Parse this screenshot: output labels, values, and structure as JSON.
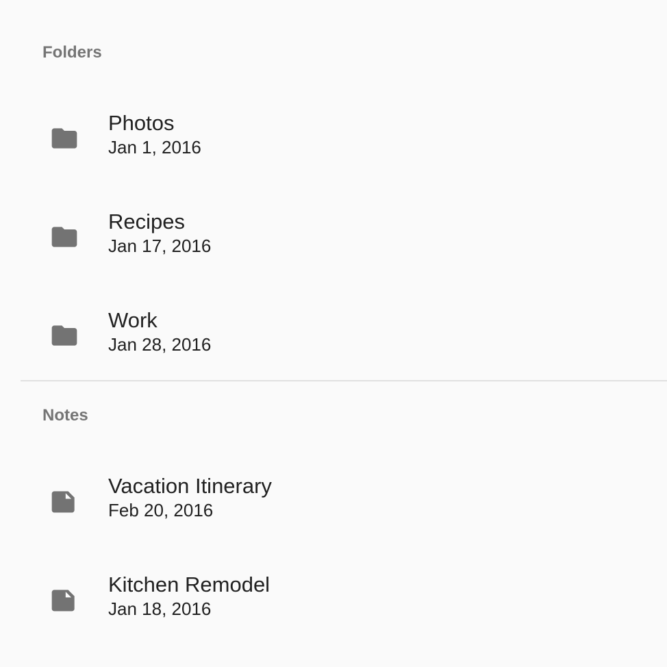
{
  "colors": {
    "background": "#fafafa",
    "subheader_text": "#757575",
    "primary_text": "#212121",
    "icon": "#737373",
    "divider": "#e0e0e0"
  },
  "sections": [
    {
      "subheader": "Folders",
      "icon": "folder-icon",
      "items": [
        {
          "title": "Photos",
          "date": "Jan 1, 2016"
        },
        {
          "title": "Recipes",
          "date": "Jan 17, 2016"
        },
        {
          "title": "Work",
          "date": "Jan 28, 2016"
        }
      ]
    },
    {
      "subheader": "Notes",
      "icon": "note-icon",
      "items": [
        {
          "title": "Vacation Itinerary",
          "date": "Feb 20, 2016"
        },
        {
          "title": "Kitchen Remodel",
          "date": "Jan 18, 2016"
        }
      ]
    }
  ]
}
